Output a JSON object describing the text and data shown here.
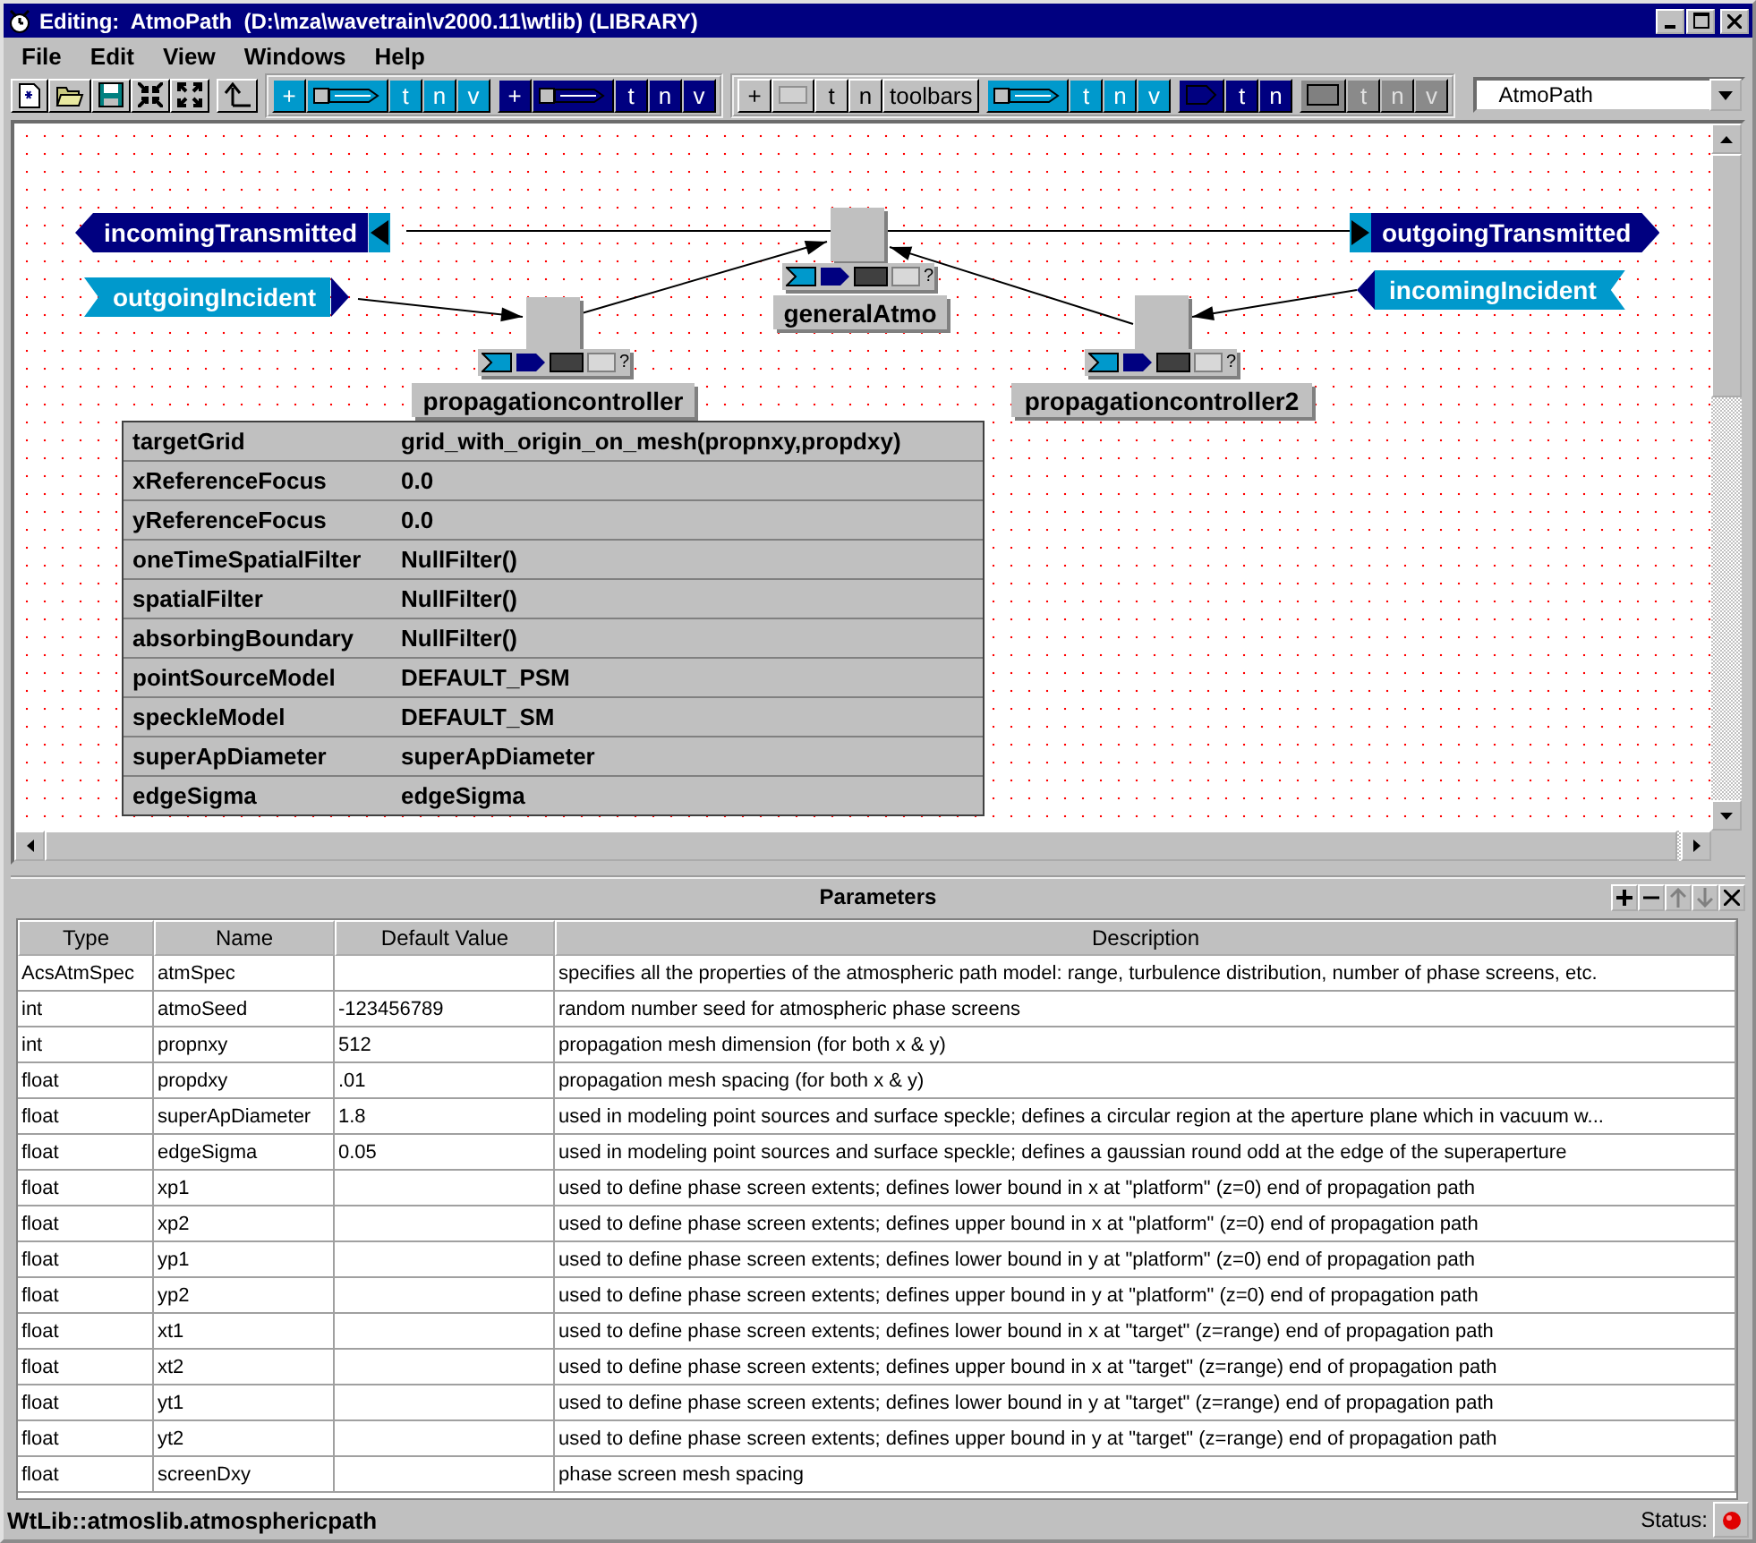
{
  "window": {
    "title": "Editing:  AtmoPath  (D:\\mza\\wavetrain\\v2000.11\\wtlib) (LIBRARY)"
  },
  "menu": [
    "File",
    "Edit",
    "View",
    "Windows",
    "Help"
  ],
  "toolbar": [
    {
      "sets": [
        {
          "items": [
            {
              "kind": "new"
            },
            {
              "kind": "open"
            },
            {
              "kind": "save"
            },
            {
              "kind": "collapse"
            },
            {
              "kind": "expand"
            }
          ]
        }
      ]
    },
    {
      "sets": [
        {
          "items": [
            {
              "kind": "up"
            }
          ]
        }
      ]
    },
    {
      "sets": [
        {
          "items": [
            {
              "kind": "text",
              "label": "+"
            },
            {
              "kind": "connector"
            },
            {
              "kind": "text",
              "label": "t"
            },
            {
              "kind": "text",
              "label": "n"
            },
            {
              "kind": "text",
              "label": "v"
            }
          ]
        },
        {
          "items": [
            {
              "kind": "text",
              "label": "+"
            },
            {
              "kind": "connector"
            },
            {
              "kind": "text",
              "label": "t"
            },
            {
              "kind": "text",
              "label": "n"
            },
            {
              "kind": "text",
              "label": "v"
            }
          ]
        }
      ]
    },
    {
      "sets": [
        {
          "items": [
            {
              "kind": "text",
              "label": "+"
            },
            {
              "kind": "blank"
            },
            {
              "kind": "text",
              "label": "t"
            },
            {
              "kind": "text",
              "label": "n"
            },
            {
              "kind": "text",
              "label": "toolbars"
            }
          ]
        },
        {
          "items": [
            {
              "kind": "connector"
            },
            {
              "kind": "text",
              "label": "t"
            },
            {
              "kind": "text",
              "label": "n"
            },
            {
              "kind": "text",
              "label": "v"
            }
          ]
        },
        {
          "items": [
            {
              "kind": "port"
            },
            {
              "kind": "text",
              "label": "t"
            },
            {
              "kind": "text",
              "label": "n"
            }
          ]
        },
        {
          "items": [
            {
              "kind": "block"
            },
            {
              "kind": "text",
              "label": "t"
            },
            {
              "kind": "text",
              "label": "n"
            },
            {
              "kind": "text",
              "label": "v"
            }
          ]
        }
      ]
    }
  ],
  "selector": {
    "value": "AtmoPath"
  },
  "diagram": {
    "ports": [
      {
        "label": "incomingTransmitted"
      },
      {
        "label": "outgoingIncident"
      },
      {
        "label": "outgoingTransmitted"
      },
      {
        "label": "incomingIncident"
      }
    ],
    "blocks": [
      {
        "label": "generalAtmo",
        "help": "?"
      },
      {
        "label": "propagationcontroller",
        "help": "?"
      },
      {
        "label": "propagationcontroller2",
        "help": "?"
      }
    ],
    "properties": [
      {
        "name": "targetGrid",
        "value": "grid_with_origin_on_mesh(propnxy,propdxy)"
      },
      {
        "name": "xReferenceFocus",
        "value": "0.0"
      },
      {
        "name": "yReferenceFocus",
        "value": "0.0"
      },
      {
        "name": "oneTimeSpatialFilter",
        "value": "NullFilter()"
      },
      {
        "name": "spatialFilter",
        "value": "NullFilter()"
      },
      {
        "name": "absorbingBoundary",
        "value": "NullFilter()"
      },
      {
        "name": "pointSourceModel",
        "value": "DEFAULT_PSM"
      },
      {
        "name": "speckleModel",
        "value": "DEFAULT_SM"
      },
      {
        "name": "superApDiameter",
        "value": "superApDiameter"
      },
      {
        "name": "edgeSigma",
        "value": "edgeSigma"
      }
    ]
  },
  "parameters": {
    "title": "Parameters",
    "buttons": [
      {
        "kind": "add",
        "disabled": false
      },
      {
        "kind": "remove",
        "disabled": false
      },
      {
        "kind": "up",
        "disabled": true
      },
      {
        "kind": "down",
        "disabled": true
      },
      {
        "kind": "close",
        "disabled": false
      }
    ],
    "columns": [
      "Type",
      "Name",
      "Default Value",
      "Description"
    ],
    "rows": [
      [
        "AcsAtmSpec",
        "atmSpec",
        "",
        "specifies all the properties of  the atmospheric path model: range, turbulence distribution, number of phase screens, etc."
      ],
      [
        "int",
        "atmoSeed",
        "-123456789",
        "random number seed for atmospheric phase screens"
      ],
      [
        "int",
        "propnxy",
        "512",
        "propagation mesh dimension  (for both x & y)"
      ],
      [
        "float",
        "propdxy",
        ".01",
        "propagation mesh spacing        (for both x & y)"
      ],
      [
        "float",
        "superApDiameter",
        "1.8",
        "used in modeling point sources and surface speckle; defines a circular region at the aperture plane which in vacuum w..."
      ],
      [
        "float",
        "edgeSigma",
        "0.05",
        "used in modeling point sources and surface speckle; defines a gaussian round odd at the edge of the superaperture"
      ],
      [
        "float",
        "xp1",
        "",
        "used to define phase screen extents; defines lower bound in x at \"platform\" (z=0) end of propagation path"
      ],
      [
        "float",
        "xp2",
        "",
        "used to define phase screen extents; defines upper bound in x at \"platform\" (z=0) end of propagation path"
      ],
      [
        "float",
        "yp1",
        "",
        "used to define phase screen extents; defines lower bound in y at \"platform\" (z=0) end of propagation path"
      ],
      [
        "float",
        "yp2",
        "",
        "used to define phase screen extents; defines upper bound in y at \"platform\" (z=0) end of propagation path"
      ],
      [
        "float",
        "xt1",
        "",
        "used to define phase screen extents; defines lower bound in x at \"target\" (z=range) end of propagation path"
      ],
      [
        "float",
        "xt2",
        "",
        "used to define phase screen extents; defines upper bound in x at \"target\" (z=range) end of propagation path"
      ],
      [
        "float",
        "yt1",
        "",
        "used to define phase screen extents; defines lower bound in y at \"target\" (z=range) end of propagation path"
      ],
      [
        "float",
        "yt2",
        "",
        "used to define phase screen extents; defines upper bound in y at \"target\" (z=range) end of propagation path"
      ],
      [
        "float",
        "screenDxy",
        "",
        "phase screen mesh spacing"
      ]
    ]
  },
  "status_bar": {
    "path": "WtLib::atmoslib.atmosphericpath",
    "label": "Status:"
  }
}
